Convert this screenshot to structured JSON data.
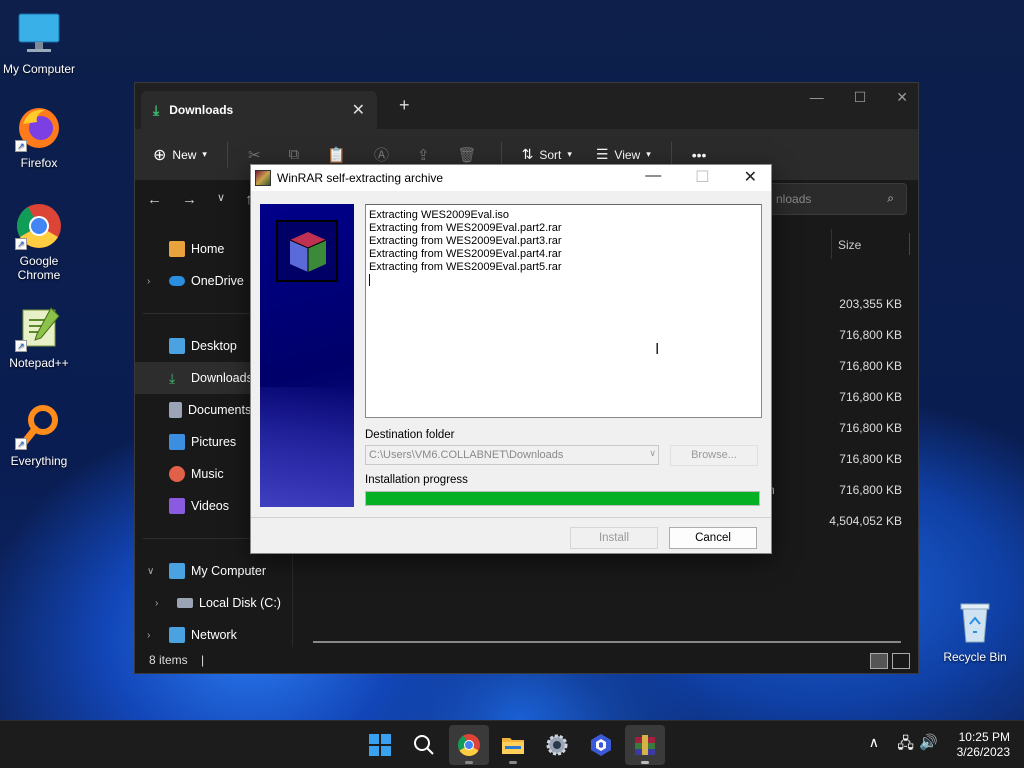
{
  "desktop": {
    "icons": [
      {
        "label": "My Computer",
        "icon": "monitor-icon"
      },
      {
        "label": "Firefox",
        "icon": "firefox-icon"
      },
      {
        "label": "Google Chrome",
        "icon": "chrome-icon"
      },
      {
        "label": "Notepad++",
        "icon": "notepadpp-icon"
      },
      {
        "label": "Everything",
        "icon": "magnifier-icon"
      },
      {
        "label": "Recycle Bin",
        "icon": "recycle-bin-icon"
      }
    ]
  },
  "explorer": {
    "tab_title": "Downloads",
    "toolbar": {
      "new": "New",
      "sort": "Sort",
      "view": "View",
      "more": "•••"
    },
    "search_placeholder": "nloads",
    "sidebar": [
      {
        "label": "Home",
        "color": "#e8a33d"
      },
      {
        "label": "OneDrive",
        "color": "#2a8fe0"
      },
      {
        "label": "Desktop",
        "color": "#4aa3e0"
      },
      {
        "label": "Downloads",
        "color": "#3fbf6f"
      },
      {
        "label": "Documents",
        "color": "#9aa4b4"
      },
      {
        "label": "Pictures",
        "color": "#3c8fe0"
      },
      {
        "label": "Music",
        "color": "#e0604a"
      },
      {
        "label": "Videos",
        "color": "#8a5ae0"
      },
      {
        "label": "My Computer",
        "color": "#4aa3e0"
      },
      {
        "label": "Local Disk (C:)",
        "color": "#9aa4b4"
      },
      {
        "label": "Network",
        "color": "#4aa3e0"
      }
    ],
    "size_header": "Size",
    "sizes": [
      "203,355 KB",
      "716,800 KB",
      "716,800 KB",
      "716,800 KB",
      "716,800 KB",
      "716,800 KB",
      "716,800 KB",
      "4,504,052 KB"
    ],
    "row_fragments": [
      "n"
    ],
    "status": "8 items"
  },
  "dialog": {
    "title": "WinRAR self-extracting archive",
    "log_lines": [
      "Extracting WES2009Eval.iso",
      "Extracting from WES2009Eval.part2.rar",
      "Extracting from WES2009Eval.part3.rar",
      "Extracting from WES2009Eval.part4.rar",
      "Extracting from WES2009Eval.part5.rar"
    ],
    "destination_label": "Destination folder",
    "destination_value": "C:\\Users\\VM6.COLLABNET\\Downloads",
    "browse_label": "Browse...",
    "progress_label": "Installation progress",
    "progress_fraction": 1.0,
    "progress_color": "#06b025",
    "install_label": "Install",
    "cancel_label": "Cancel"
  },
  "taskbar": {
    "apps": [
      "windows-start-icon",
      "search-icon",
      "chrome-icon",
      "file-explorer-icon",
      "settings-gear-icon",
      "app-icon",
      "winrar-icon"
    ],
    "time": "10:25 PM",
    "date": "3/26/2023"
  }
}
